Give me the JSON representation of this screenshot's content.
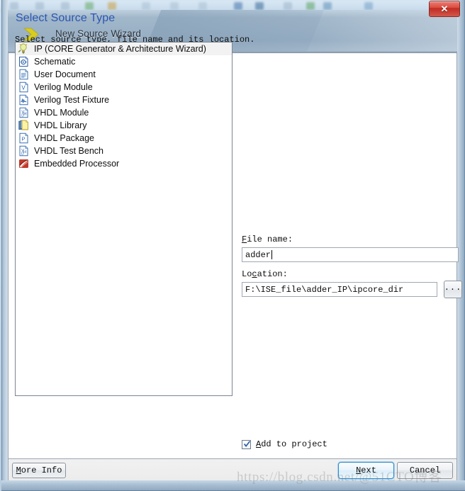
{
  "window": {
    "title": "New Source Wizard",
    "close_label": "✕",
    "arrow_icon": "chevron-right-icon"
  },
  "page": {
    "heading": "Select Source Type",
    "instruction": "Select source type, file name and its location."
  },
  "source_list": {
    "selected_index": 0,
    "items": [
      {
        "label": "IP (CORE Generator & Architecture Wizard)",
        "icon": "ip-core-bulb-icon"
      },
      {
        "label": "Schematic",
        "icon": "schematic-icon"
      },
      {
        "label": "User Document",
        "icon": "user-document-icon"
      },
      {
        "label": "Verilog Module",
        "icon": "verilog-module-icon"
      },
      {
        "label": "Verilog Test Fixture",
        "icon": "verilog-test-fixture-icon"
      },
      {
        "label": "VHDL Module",
        "icon": "vhdl-module-icon"
      },
      {
        "label": "VHDL Library",
        "icon": "vhdl-library-icon"
      },
      {
        "label": "VHDL Package",
        "icon": "vhdl-package-icon"
      },
      {
        "label": "VHDL Test Bench",
        "icon": "vhdl-test-bench-icon"
      },
      {
        "label": "Embedded Processor",
        "icon": "embedded-processor-icon"
      }
    ]
  },
  "form": {
    "filename": {
      "label_accel": "F",
      "label_rest": "ile name:",
      "value": "adder",
      "placeholder": ""
    },
    "location": {
      "label_pre": "Lo",
      "label_accel": "c",
      "label_rest": "ation:",
      "value": "F:\\ISE_file\\adder_IP\\ipcore_dir",
      "placeholder": ""
    },
    "browse_label": "...",
    "add_to_project": {
      "checked": true,
      "label_accel": "A",
      "label_rest": "dd to project"
    }
  },
  "footer": {
    "more_info": {
      "accel": "M",
      "rest": "ore Info"
    },
    "next": {
      "accel": "N",
      "rest": "ext"
    },
    "cancel": {
      "accel": "",
      "rest": "Cancel"
    }
  },
  "watermark": {
    "text": "https://blog.csdn.net/@51CTO博客"
  },
  "colors": {
    "heading_blue": "#2b56b3",
    "default_button_border": "#2e8ccf",
    "close_button_red": "#c02d22",
    "selection_gray": "#f2f2f2",
    "arrow_yellow": "#d4c71e"
  }
}
